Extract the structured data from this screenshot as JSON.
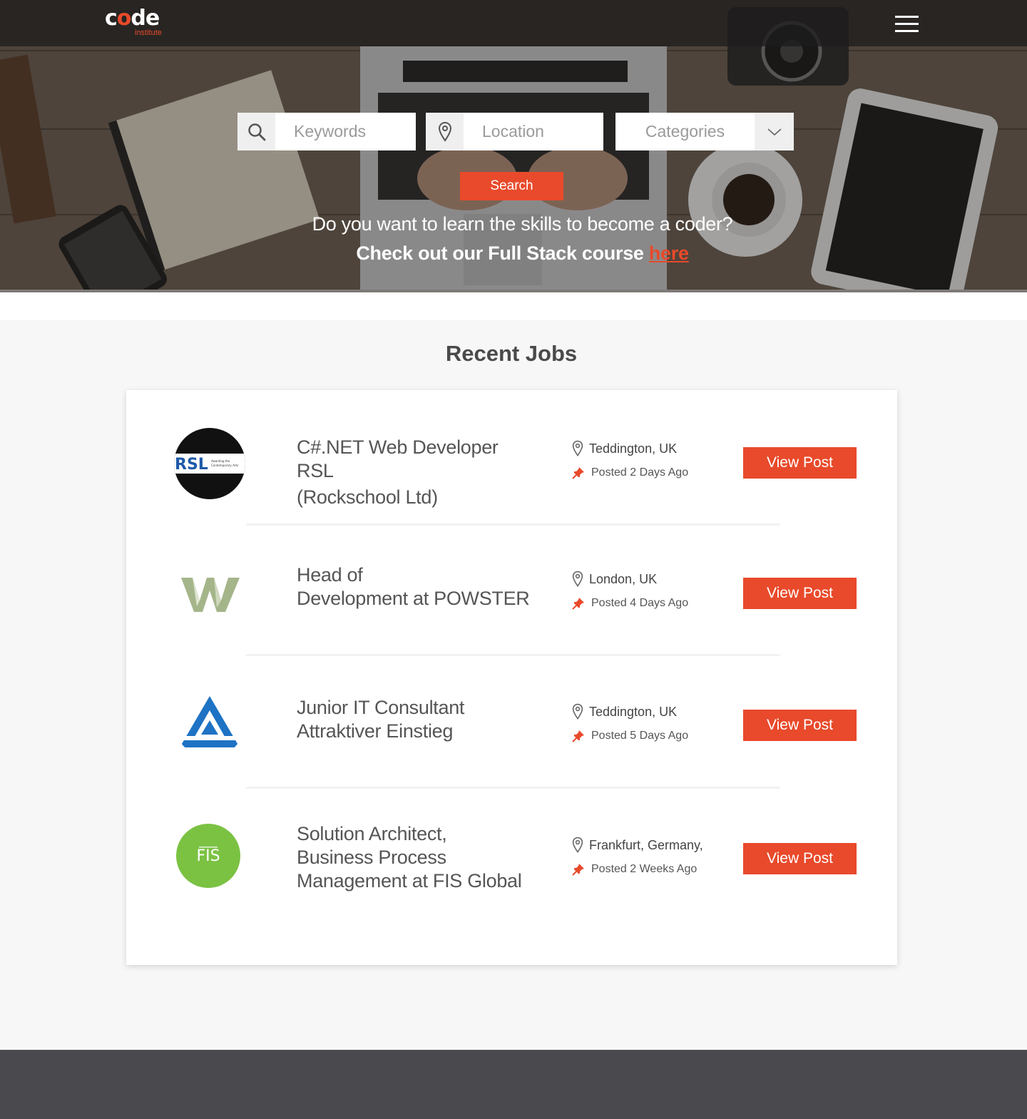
{
  "nav": {
    "logo_word_pre": "c",
    "logo_word_o": "o",
    "logo_word_post": "de",
    "logo_sub": "institute",
    "menu_icon": "hamburger-menu-icon"
  },
  "search": {
    "keywords_placeholder": "Keywords",
    "location_placeholder": "Location",
    "categories_value": "Categories",
    "button_label": "Search"
  },
  "promo": {
    "question": "Do you want to learn the skills to become a coder?",
    "cta_text": "Check out our Full Stack course ",
    "cta_link": "here"
  },
  "recent_jobs": {
    "title": "Recent Jobs",
    "jobs": [
      {
        "title_line1": "C#.NET Web Developer RSL",
        "title_line2": "(Rockschool Ltd)",
        "title_line3": "",
        "location": "Teddington, UK",
        "posted": "Posted 2 Days Ago",
        "button": "View Post",
        "logo_text": "RSL",
        "logo_subtext": "Awarding the Contemporary Arts"
      },
      {
        "title_line1": "Head of",
        "title_line2": "Development at POWSTER",
        "title_line3": "",
        "location": "London, UK",
        "posted": "Posted 4 Days Ago",
        "button": "View Post",
        "logo_text": "",
        "logo_subtext": ""
      },
      {
        "title_line1": "Junior IT Consultant",
        "title_line2": "Attraktiver Einstieg",
        "title_line3": "",
        "location": "Teddington, UK",
        "posted": "Posted 5 Days Ago",
        "button": "View Post",
        "logo_text": "",
        "logo_subtext": ""
      },
      {
        "title_line1": "Solution Architect,",
        "title_line2": "Business Process",
        "title_line3": "Management at FIS Global",
        "location": "Frankfurt, Germany,",
        "posted": "Posted 2 Weeks Ago",
        "button": "View Post",
        "logo_text": "FIS",
        "logo_subtext": ""
      }
    ]
  },
  "colors": {
    "accent": "#e84a2b",
    "text": "#4a4a4a",
    "footer": "#4a4a4e",
    "fis_green": "#7bc243",
    "blue_logo": "#1e73c4"
  }
}
